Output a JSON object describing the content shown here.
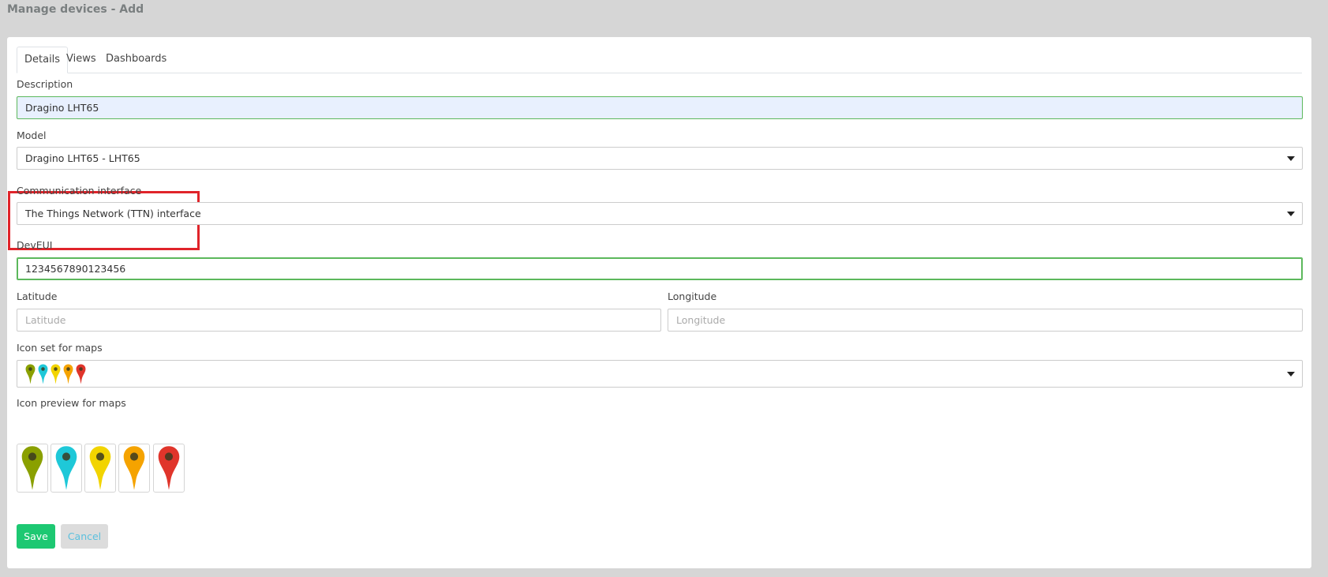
{
  "page": {
    "title": "Manage devices - Add"
  },
  "tabs": [
    {
      "label": "Details",
      "active": true
    },
    {
      "label": "Views",
      "active": false
    },
    {
      "label": "Dashboards",
      "active": false
    }
  ],
  "form": {
    "description": {
      "label": "Description",
      "value": "Dragino LHT65"
    },
    "model": {
      "label": "Model",
      "value": "Dragino LHT65 - LHT65"
    },
    "interface": {
      "label": "Communication interface",
      "value": "The Things Network (TTN) interface"
    },
    "deveui": {
      "label": "DevEUI",
      "value": "1234567890123456"
    },
    "latitude": {
      "label": "Latitude",
      "placeholder": "Latitude",
      "value": ""
    },
    "longitude": {
      "label": "Longitude",
      "placeholder": "Longitude",
      "value": ""
    },
    "iconset": {
      "label": "Icon set for maps",
      "icons": [
        "map-pin-olive-icon",
        "map-pin-cyan-icon",
        "map-pin-yellow-icon",
        "map-pin-orange-icon",
        "map-pin-red-icon"
      ]
    },
    "preview": {
      "label": "Icon preview for maps"
    }
  },
  "pin_colors": [
    "#8aa000",
    "#1ec8d8",
    "#f2d400",
    "#f5a300",
    "#e0352b"
  ],
  "buttons": {
    "save": "Save",
    "cancel": "Cancel"
  },
  "colors": {
    "highlight": "#e0242a",
    "save": "#1dc872",
    "cancel_text": "#5bc0de"
  }
}
